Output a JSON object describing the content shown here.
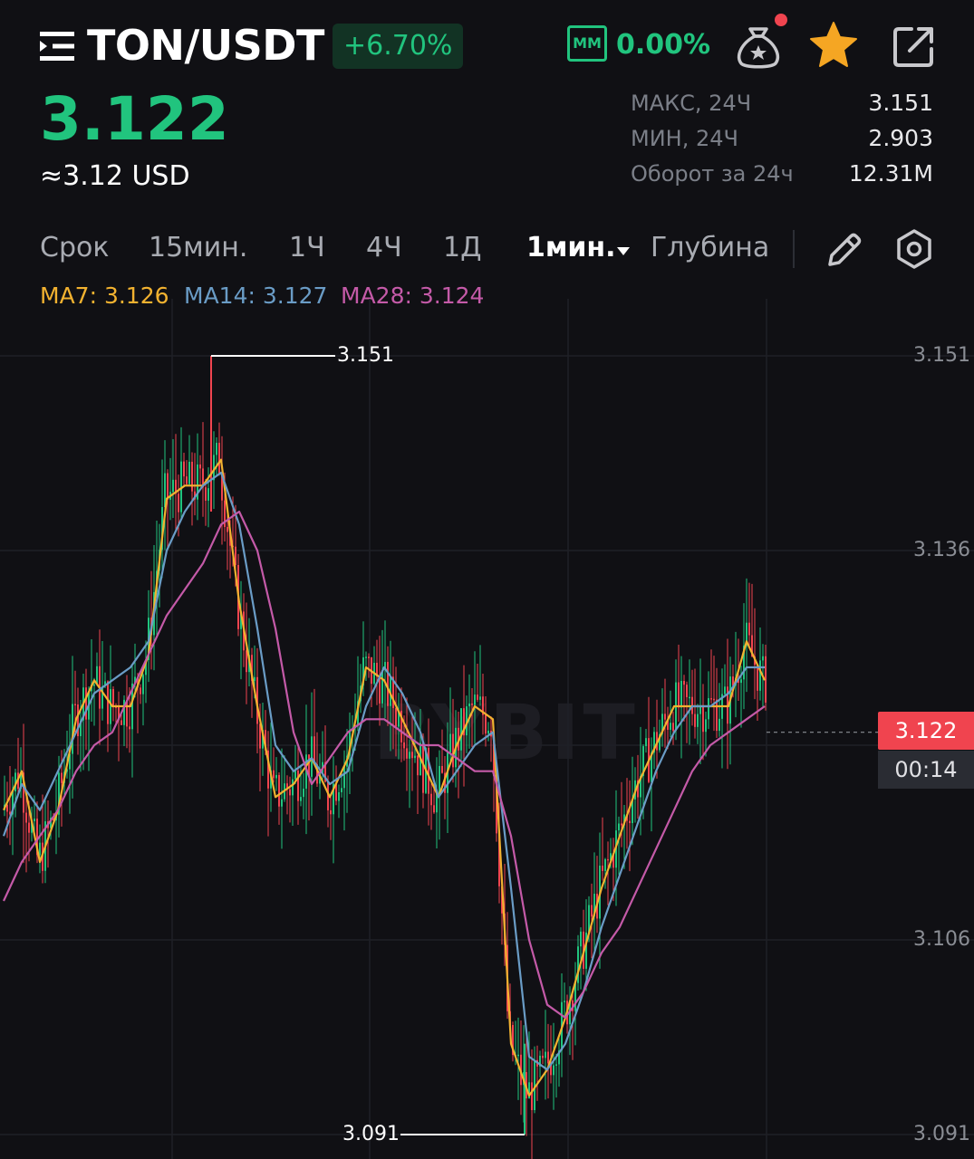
{
  "header": {
    "pair": "TON/USDT",
    "change": "+6.70%",
    "mm_label": "MM",
    "mm_value": "0.00%"
  },
  "price": {
    "last": "3.122",
    "usd": "≈3.12 USD"
  },
  "stats": [
    {
      "label": "МАКС, 24Ч",
      "value": "3.151"
    },
    {
      "label": "МИН, 24Ч",
      "value": "2.903"
    },
    {
      "label": "Оборот за 24ч",
      "value": "12.31M"
    }
  ],
  "tabs": {
    "term": "Срок",
    "m15": "15мин.",
    "h1": "1Ч",
    "h4": "4Ч",
    "d1": "1Д",
    "active": "1мин.",
    "depth": "Глубина"
  },
  "ma": {
    "ma7": "MA7: 3.126",
    "ma14": "MA14: 3.127",
    "ma28": "MA28: 3.124"
  },
  "colors": {
    "up": "#21c47e",
    "down": "#f0444f",
    "ma7": "#f2b230",
    "ma14": "#6a9cc6",
    "ma28": "#c45aa8",
    "star": "#f5a623"
  },
  "icons": [
    "menu-icon",
    "moneybag-icon",
    "star-icon",
    "external-link-icon",
    "pencil-icon",
    "settings-icon",
    "caret-down-icon"
  ],
  "chart_data": {
    "type": "line",
    "interval": "1мин.",
    "y_ticks": [
      "3.151",
      "3.136",
      "3.106",
      "3.091"
    ],
    "ylim": [
      3.0875,
      3.1545
    ],
    "grid": true,
    "high": "3.151",
    "low": "3.091",
    "current_price": "3.122",
    "countdown": "00:14",
    "watermark": "BYBIT",
    "x": [
      0,
      20,
      40,
      60,
      80,
      100,
      120,
      140,
      160,
      180,
      200,
      220,
      240,
      260,
      280,
      300,
      320,
      340,
      360,
      380,
      400,
      420,
      440,
      460,
      480,
      500,
      520,
      540,
      560,
      580,
      600,
      620,
      640,
      660,
      680,
      700,
      720,
      740,
      760,
      780,
      800,
      820,
      840
    ],
    "series": [
      {
        "name": "MA7",
        "values": [
          3.116,
          3.119,
          3.112,
          3.116,
          3.123,
          3.126,
          3.124,
          3.124,
          3.128,
          3.14,
          3.141,
          3.141,
          3.143,
          3.132,
          3.124,
          3.117,
          3.118,
          3.12,
          3.117,
          3.12,
          3.127,
          3.126,
          3.123,
          3.12,
          3.117,
          3.121,
          3.124,
          3.123,
          3.098,
          3.094,
          3.096,
          3.1,
          3.105,
          3.11,
          3.114,
          3.118,
          3.121,
          3.124,
          3.124,
          3.124,
          3.124,
          3.129,
          3.126
        ]
      },
      {
        "name": "MA14",
        "values": [
          3.114,
          3.118,
          3.116,
          3.119,
          3.122,
          3.125,
          3.126,
          3.127,
          3.129,
          3.136,
          3.139,
          3.141,
          3.142,
          3.138,
          3.13,
          3.121,
          3.119,
          3.12,
          3.118,
          3.119,
          3.124,
          3.127,
          3.125,
          3.122,
          3.117,
          3.119,
          3.121,
          3.122,
          3.11,
          3.097,
          3.096,
          3.098,
          3.102,
          3.107,
          3.111,
          3.115,
          3.119,
          3.122,
          3.124,
          3.124,
          3.125,
          3.127,
          3.127
        ]
      },
      {
        "name": "MA28",
        "values": [
          3.109,
          3.112,
          3.114,
          3.116,
          3.119,
          3.121,
          3.122,
          3.125,
          3.128,
          3.131,
          3.133,
          3.135,
          3.138,
          3.139,
          3.136,
          3.13,
          3.122,
          3.118,
          3.12,
          3.122,
          3.123,
          3.123,
          3.122,
          3.121,
          3.121,
          3.12,
          3.119,
          3.119,
          3.114,
          3.106,
          3.101,
          3.1,
          3.102,
          3.105,
          3.107,
          3.11,
          3.113,
          3.116,
          3.119,
          3.121,
          3.122,
          3.123,
          3.124
        ]
      }
    ]
  }
}
